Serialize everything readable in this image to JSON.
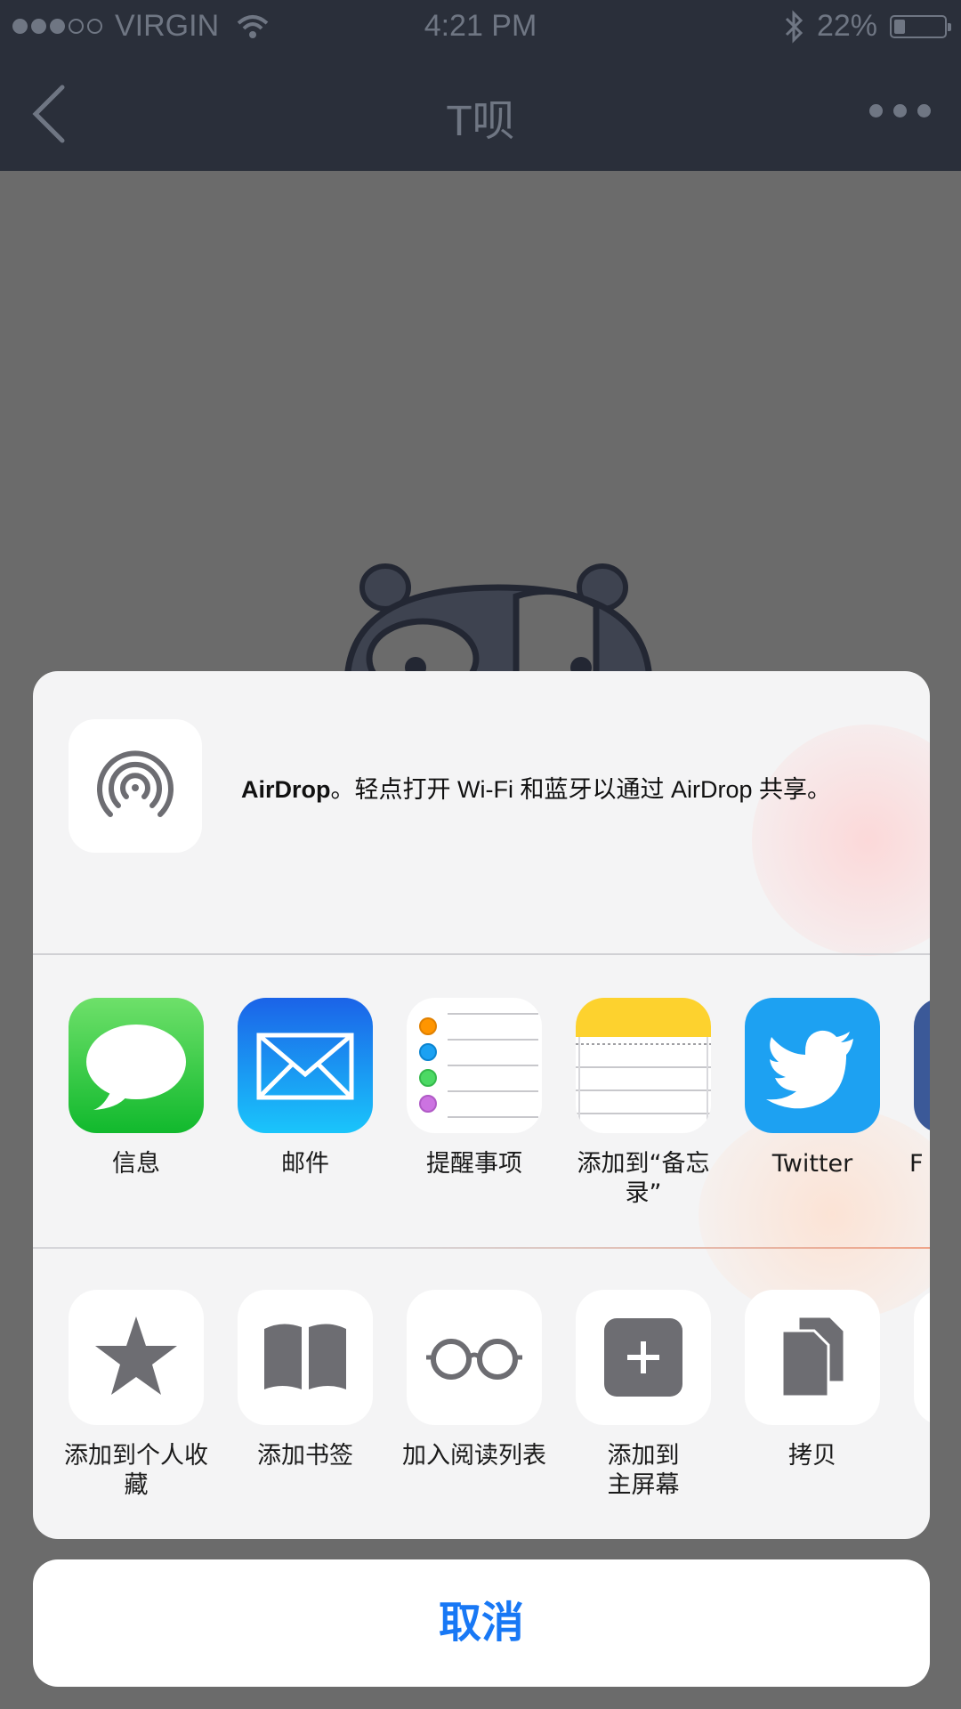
{
  "status_bar": {
    "carrier": "VIRGIN",
    "time": "4:21 PM",
    "battery": "22%",
    "battery_level": 0.22,
    "signal_bars": 3,
    "icons": [
      "wifi-icon",
      "bluetooth-icon",
      "battery-icon"
    ]
  },
  "nav": {
    "title": "T呗",
    "back_icon": "chevron-left-icon",
    "more_icon": "more-dots-icon"
  },
  "airdrop": {
    "name": "AirDrop",
    "message": "。轻点打开 Wi-Fi 和蓝牙以通过 AirDrop 共享。"
  },
  "apps": [
    {
      "label": "信息",
      "icon": "messages-icon"
    },
    {
      "label": "邮件",
      "icon": "mail-icon"
    },
    {
      "label": "提醒事项",
      "icon": "reminders-icon"
    },
    {
      "label": "添加到“备忘录”",
      "icon": "notes-icon"
    },
    {
      "label": "Twitter",
      "icon": "twitter-icon"
    },
    {
      "label": "F",
      "icon": "facebook-icon"
    }
  ],
  "actions": [
    {
      "label": "添加到个人收藏",
      "icon": "star-icon"
    },
    {
      "label": "添加书签",
      "icon": "book-icon"
    },
    {
      "label": "加入阅读列表",
      "icon": "glasses-icon"
    },
    {
      "label": "添加到主屏幕",
      "icon": "add-square-icon"
    },
    {
      "label": "拷贝",
      "icon": "copy-icon"
    }
  ],
  "cancel_label": "取消",
  "colors": {
    "accent": "#1878f5",
    "navbar": "#2a2f3a",
    "sheet": "#f4f4f5"
  }
}
